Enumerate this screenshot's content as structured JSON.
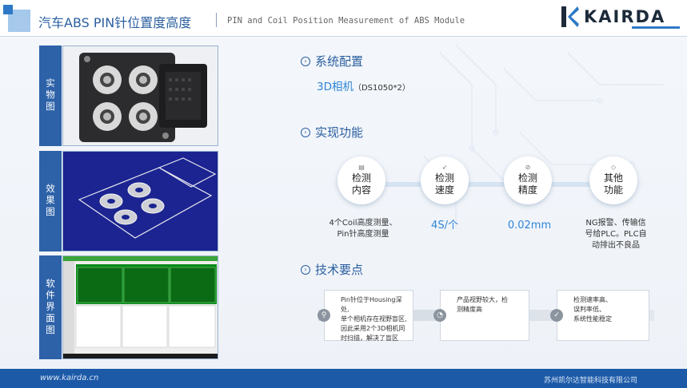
{
  "header": {
    "title_cn": "汽车ABS PIN针位置度高度",
    "title_en": "PIN and Coil Position Measurement of ABS Module",
    "logo_text": "KAIRDA"
  },
  "left_panels": {
    "labels": [
      "实物图",
      "效果图",
      "软件界面图"
    ]
  },
  "config": {
    "heading": "系统配置",
    "camera": "3D相机",
    "camera_model": "（DS1050*2）"
  },
  "functions": {
    "heading": "实现功能",
    "items": [
      {
        "title": "检测\n内容",
        "desc": "4个Coil高度测量、\nPin针高度测量"
      },
      {
        "title": "检测\n速度",
        "desc": "4S/个"
      },
      {
        "title": "检测\n精度",
        "desc": "0.02mm"
      },
      {
        "title": "其他\n功能",
        "desc": "NG报警、传输信\n号给PLC。PLC自\n动排出不良品"
      }
    ]
  },
  "tech": {
    "heading": "技术要点",
    "points": [
      "Pin针位于Housing深处,\n单个相机存在视野盲区,\n因此采用2个3D相机同\n时扫描，解决了盲区",
      "产品视野较大，检\n测精度高",
      "检测速率高、\n误判率低、\n系统性能稳定"
    ]
  },
  "footer": {
    "url": "www.kairda.cn",
    "company": "苏州凯尔达智能科技有限公司"
  },
  "colors": {
    "brand_blue": "#2d62a8",
    "accent_blue": "#2f85d8",
    "footer": "#1c5aa8"
  }
}
